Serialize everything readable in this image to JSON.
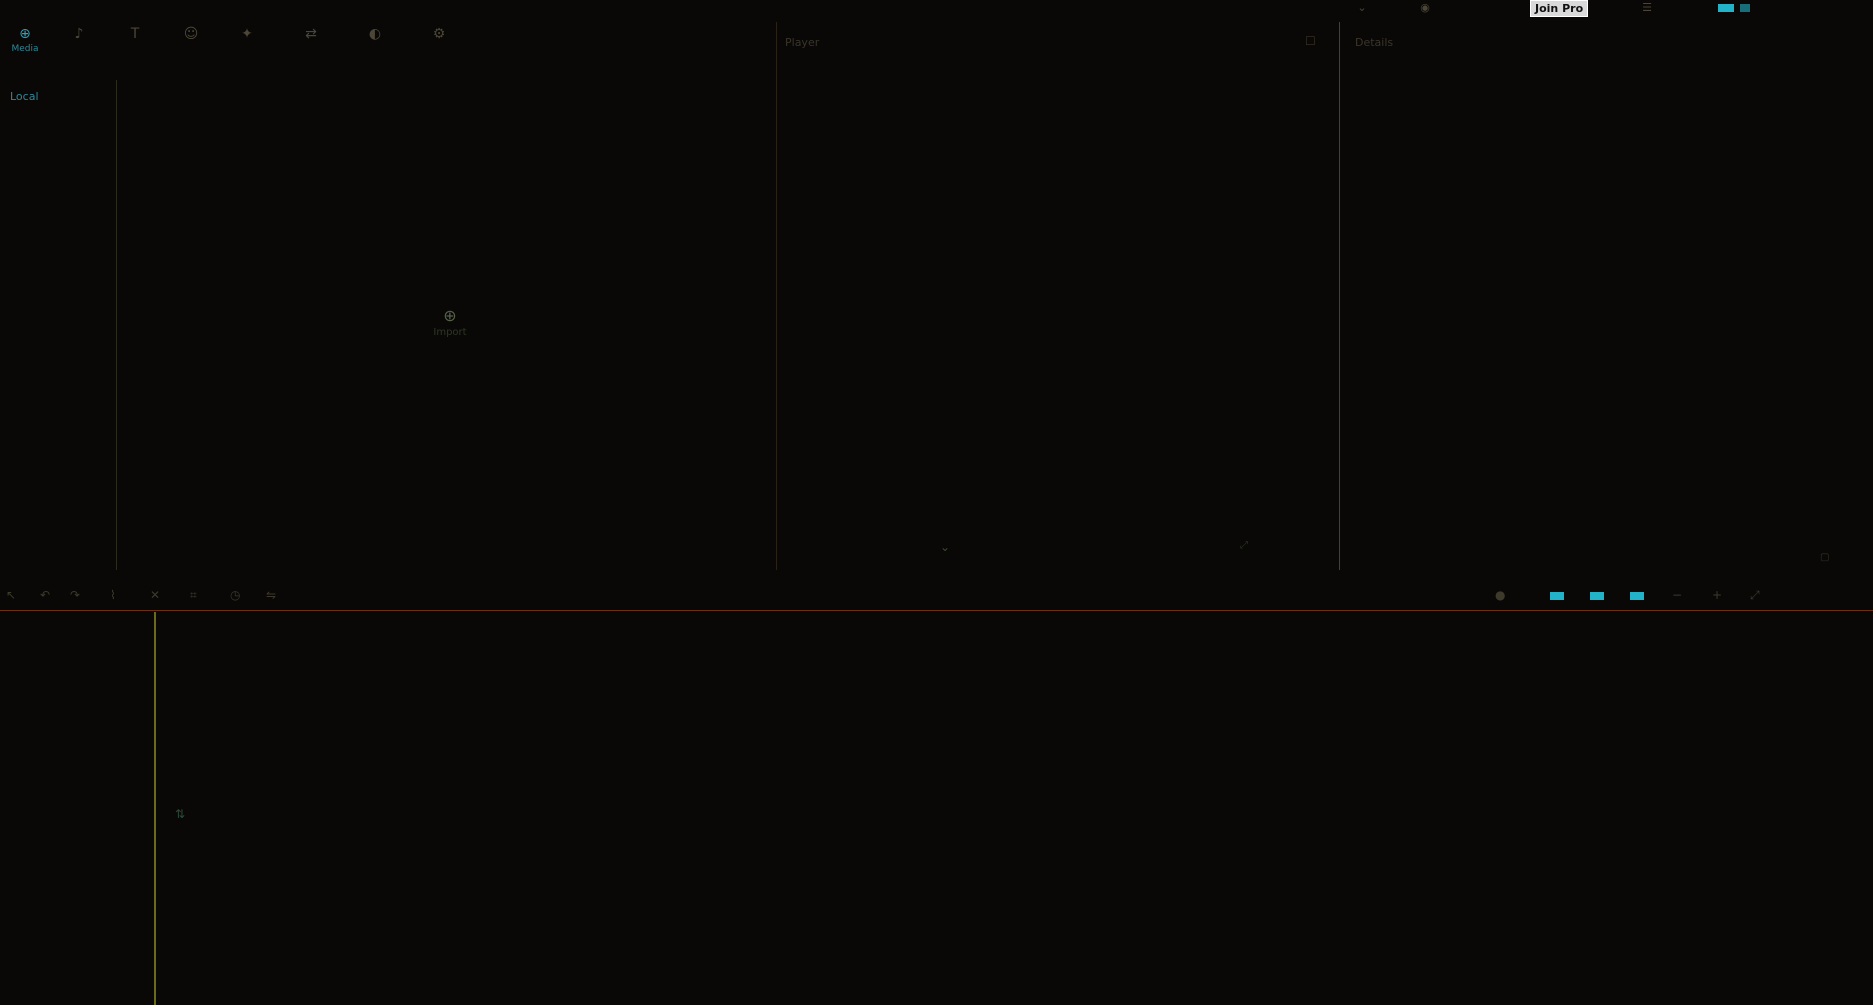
{
  "window": {
    "app_title": "",
    "center_title": "",
    "join_label": "Join Pro"
  },
  "toolbar": {
    "items": [
      {
        "icon": "media-icon",
        "label": "Media"
      },
      {
        "icon": "audio-icon",
        "label": ""
      },
      {
        "icon": "text-icon",
        "label": ""
      },
      {
        "icon": "stickers-icon",
        "label": ""
      },
      {
        "icon": "effects-icon",
        "label": ""
      },
      {
        "icon": "transitions-icon",
        "label": ""
      },
      {
        "icon": "filters-icon",
        "label": ""
      },
      {
        "icon": "adjust-icon",
        "label": ""
      }
    ]
  },
  "left_nav": {
    "items": [
      {
        "label": "Local",
        "active": true
      },
      {
        "label": "",
        "active": false
      },
      {
        "label": "",
        "active": false
      },
      {
        "label": "",
        "active": false
      }
    ]
  },
  "media": {
    "empty_text": "Import"
  },
  "player": {
    "title": "Player"
  },
  "details": {
    "title": "Details",
    "rows": [
      {
        "key": "",
        "value": ""
      },
      {
        "key": "",
        "value": ""
      },
      {
        "key": "",
        "value": ""
      },
      {
        "key": "",
        "value": ""
      },
      {
        "key": "",
        "value": ""
      },
      {
        "key": "",
        "value": ""
      },
      {
        "key": "",
        "value": ""
      },
      {
        "key": "",
        "value": ""
      }
    ]
  },
  "timeline": {
    "hint": ""
  },
  "colors": {
    "accent": "#22b3c8",
    "background": "#090806",
    "divider": "#6a2f12",
    "playhead": "#6b6a1a"
  }
}
